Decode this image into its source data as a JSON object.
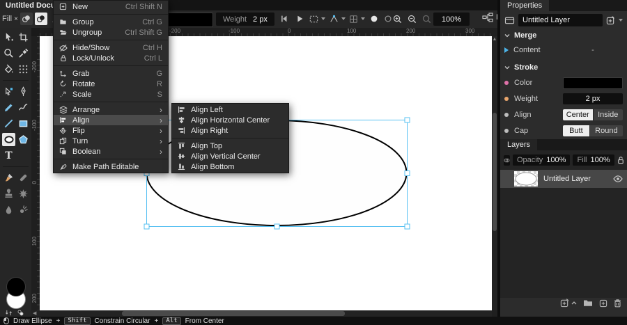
{
  "titlebar": {
    "document_tab": "Untitled Docume"
  },
  "options_bar": {
    "fill_label": "Fill",
    "fill_none_glyph": "×",
    "weight_label": "Weight",
    "weight_value": "2 px",
    "zoom_value": "100%",
    "node_graph_text": "N"
  },
  "context_menu": {
    "submenu_arrow": "›",
    "items": [
      {
        "label": "New",
        "shortcut": "Ctrl Shift N"
      },
      {
        "label": "Group",
        "shortcut": "Ctrl G"
      },
      {
        "label": "Ungroup",
        "shortcut": "Ctrl Shift G"
      },
      {
        "label": "Hide/Show",
        "shortcut": "Ctrl H"
      },
      {
        "label": "Lock/Unlock",
        "shortcut": "Ctrl L"
      },
      {
        "label": "Grab",
        "shortcut": "G"
      },
      {
        "label": "Rotate",
        "shortcut": "R"
      },
      {
        "label": "Scale",
        "shortcut": "S"
      },
      {
        "label": "Arrange"
      },
      {
        "label": "Align"
      },
      {
        "label": "Flip"
      },
      {
        "label": "Turn"
      },
      {
        "label": "Boolean"
      },
      {
        "label": "Make Path Editable"
      }
    ]
  },
  "align_submenu": {
    "items": [
      {
        "label": "Align Left"
      },
      {
        "label": "Align Horizontal Center"
      },
      {
        "label": "Align Right"
      },
      {
        "label": "Align Top"
      },
      {
        "label": "Align Vertical Center"
      },
      {
        "label": "Align Bottom"
      }
    ]
  },
  "viewport": {
    "h_ruler_labels": [
      "-200",
      "-100",
      "0",
      "100",
      "200",
      "300"
    ],
    "v_ruler_labels": [
      "-200",
      "-100",
      "0",
      "100",
      "200"
    ]
  },
  "properties_panel": {
    "tab": "Properties",
    "layer_name": "Untitled Layer",
    "merge_title": "Merge",
    "content_label": "Content",
    "content_value": "-",
    "stroke_title": "Stroke",
    "color_label": "Color",
    "weight_label": "Weight",
    "weight_value": "2 px",
    "align_label": "Align",
    "align_center": "Center",
    "align_inside": "Inside",
    "cap_label": "Cap",
    "cap_butt": "Butt",
    "cap_round": "Round"
  },
  "layers_panel": {
    "tab": "Layers",
    "opacity_label": "Opacity",
    "opacity_value": "100%",
    "fill_label": "Fill",
    "fill_value": "100%",
    "layers": [
      {
        "name": "Untitled Layer"
      }
    ]
  },
  "status_bar": {
    "action": "Draw Ellipse",
    "plus": "+",
    "shift_key": "Shift",
    "shift_hint": "Constrain Circular",
    "alt_key": "Alt",
    "alt_hint": "From Center"
  },
  "tools": {
    "text_tool_glyph": "T"
  },
  "colors": {
    "selection_blue": "#56c0f2",
    "stroke_color": "#000000",
    "param_color_dot": "#df72a9",
    "param_number_dot": "#e9a66d",
    "accent_arrow": "#4db4e7"
  }
}
